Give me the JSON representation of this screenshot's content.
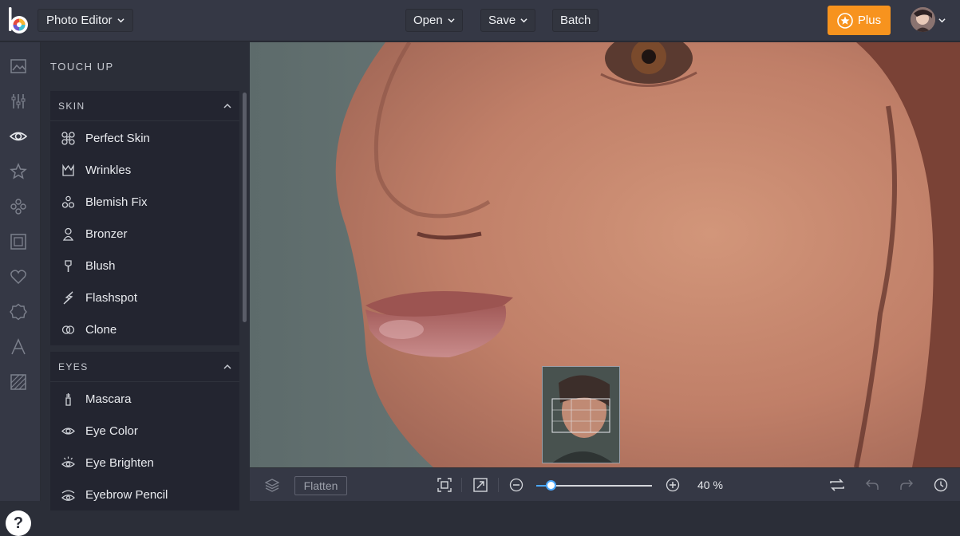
{
  "topbar": {
    "app_menu": "Photo Editor",
    "open": "Open",
    "save": "Save",
    "batch": "Batch",
    "plus": "Plus",
    "accent": "#f7931e"
  },
  "rail": {
    "icons": [
      "image-icon",
      "adjust-sliders-icon",
      "eye-icon",
      "star-icon",
      "effects-icon",
      "frame-icon",
      "heart-icon",
      "badge-icon",
      "text-icon",
      "texture-icon"
    ],
    "help": "?"
  },
  "panel": {
    "title": "TOUCH UP",
    "sections": [
      {
        "title": "SKIN",
        "tools": [
          "Perfect Skin",
          "Wrinkles",
          "Blemish Fix",
          "Bronzer",
          "Blush",
          "Flashspot",
          "Clone"
        ]
      },
      {
        "title": "EYES",
        "tools": [
          "Mascara",
          "Eye Color",
          "Eye Brighten",
          "Eyebrow Pencil"
        ]
      }
    ]
  },
  "bottombar": {
    "flatten": "Flatten",
    "zoom": "40 %",
    "zoom_level": 0.13
  }
}
